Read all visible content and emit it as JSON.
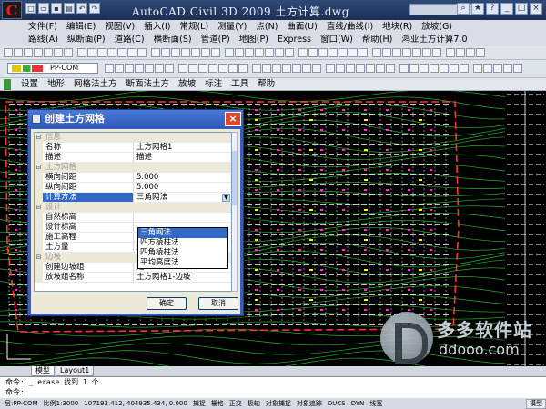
{
  "app": {
    "title": "AutoCAD Civil 3D 2009  土方计算.dwg",
    "logo_letter": "C"
  },
  "menu_row1": [
    "文件(F)",
    "编辑(E)",
    "视图(V)",
    "插入(I)",
    "常规(L)",
    "测量(Y)",
    "点(N)",
    "曲面(U)",
    "直线/曲线(I)",
    "地块(R)",
    "放坡(G)"
  ],
  "menu_row2": [
    "路线(A)",
    "纵断面(P)",
    "道路(C)",
    "横断面(S)",
    "管道(P)",
    "地图(P)",
    "Express",
    "窗口(W)",
    "帮助(H)",
    "鸿业土方计算7.0"
  ],
  "layer_combo": {
    "value": "PP-COM"
  },
  "plugin_toolbar": [
    "设置",
    "地形",
    "网格法土方",
    "断面法土方",
    "放坡",
    "标注",
    "工具",
    "帮助"
  ],
  "dialog": {
    "title": "创建土方网格",
    "rows": [
      {
        "kind": "cat",
        "key": "信息",
        "value": ""
      },
      {
        "kind": "prop",
        "key": "名称",
        "value": "土方网格1"
      },
      {
        "kind": "prop",
        "key": "描述",
        "value": "描述"
      },
      {
        "kind": "cat",
        "key": "土方网格",
        "value": ""
      },
      {
        "kind": "prop",
        "key": "横向间距",
        "value": "5.000"
      },
      {
        "kind": "prop",
        "key": "纵向间距",
        "value": "5.000"
      },
      {
        "kind": "sel",
        "key": "计算方法",
        "value": "三角网法"
      },
      {
        "kind": "cat",
        "key": "设计",
        "value": ""
      },
      {
        "kind": "prop",
        "key": "自然标高",
        "value": ""
      },
      {
        "kind": "prop",
        "key": "设计标高",
        "value": ""
      },
      {
        "kind": "prop",
        "key": "施工高程",
        "value": ""
      },
      {
        "kind": "prop",
        "key": "土方量",
        "value": "是"
      },
      {
        "kind": "cat",
        "key": "边坡",
        "value": ""
      },
      {
        "kind": "prop",
        "key": "创建边坡组",
        "value": "是"
      },
      {
        "kind": "prop",
        "key": "放坡组名称",
        "value": "土方网格1-边坡"
      }
    ],
    "dropdown_options": [
      "三角网法",
      "四方棱柱法",
      "四角棱柱法",
      "平均高度法"
    ],
    "dropdown_selected_index": 0,
    "ok_label": "确定",
    "cancel_label": "取消"
  },
  "tabs": [
    "模型",
    "Layout1"
  ],
  "command_lines": [
    "命令: _.erase 找到 1 个",
    "命令:"
  ],
  "status": {
    "layer": "层:PP-COM",
    "scale": "比例1:3000",
    "coords": "107193.412, 404935.434, 0.000",
    "modes": [
      "捕捉",
      "栅格",
      "正交",
      "极轴",
      "对象捕捉",
      "对象追踪",
      "DUCS",
      "DYN",
      "线宽"
    ],
    "model": "模型"
  },
  "watermark": {
    "brand": "多多软件站",
    "url": "ddooo.com"
  },
  "colors": {
    "drawing_bg": "#000000",
    "grid_white": "#ffffff",
    "contour_green": "#33cc33",
    "boundary_red": "#ff3333",
    "marker_magenta": "#ff33cc",
    "marker_yellow": "#ffff00",
    "selection_blue": "#316ac5"
  },
  "icons": [
    "search-icon",
    "close-icon",
    "minimize-icon",
    "maximize-icon",
    "undo-icon",
    "redo-icon",
    "layer-icon",
    "dialog-icon"
  ]
}
